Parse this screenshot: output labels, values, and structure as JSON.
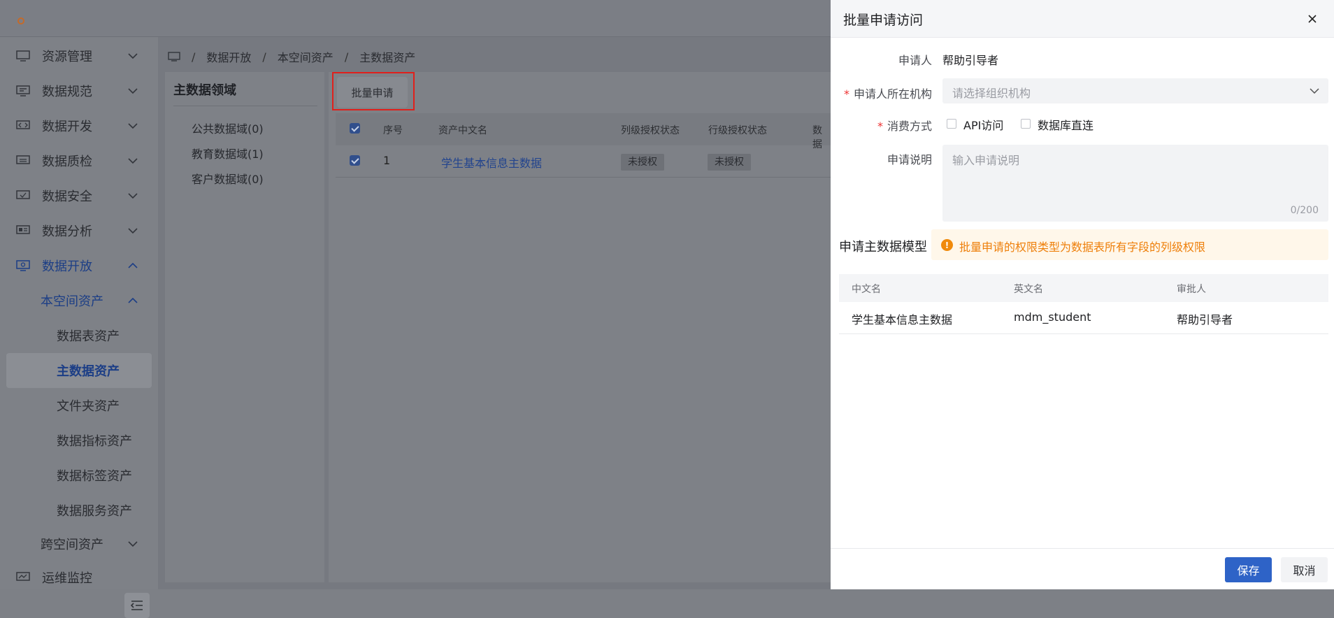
{
  "sidebar": {
    "items": [
      {
        "label": "资源管理"
      },
      {
        "label": "数据规范"
      },
      {
        "label": "数据开发"
      },
      {
        "label": "数据质检"
      },
      {
        "label": "数据安全"
      },
      {
        "label": "数据分析"
      },
      {
        "label": "数据开放"
      }
    ],
    "sub": {
      "label": "本空间资产"
    },
    "leaves": [
      {
        "label": "数据表资产"
      },
      {
        "label": "主数据资产"
      },
      {
        "label": "文件夹资产"
      },
      {
        "label": "数据指标资产"
      },
      {
        "label": "数据标签资产"
      },
      {
        "label": "数据服务资产"
      }
    ],
    "sub2": {
      "label": "跨空间资产"
    },
    "ops": {
      "label": "运维监控"
    }
  },
  "breadcrumb": [
    "数据开放",
    "本空间资产",
    "主数据资产"
  ],
  "left_panel": {
    "title": "主数据领域",
    "domains": [
      "公共数据域(0)",
      "教育数据域(1)",
      "客户数据域(0)"
    ]
  },
  "toolbar": {
    "batch_label": "批量申请"
  },
  "table": {
    "headers": [
      "序号",
      "资产中文名",
      "列级授权状态",
      "行级授权状态",
      "数据"
    ],
    "rows": [
      {
        "index": "1",
        "name": "学生基本信息主数据",
        "col_status": "未授权",
        "row_status": "未授权"
      }
    ]
  },
  "drawer": {
    "title": "批量申请访问",
    "applicant_label": "申请人",
    "applicant_value": "帮助引导者",
    "org_label": "申请人所在机构",
    "org_placeholder": "请选择组织机构",
    "consume_label": "消费方式",
    "consume_options": [
      "API访问",
      "数据库直连"
    ],
    "desc_label": "申请说明",
    "desc_placeholder": "输入申请说明",
    "desc_count": "0/200",
    "section_title": "申请主数据模型",
    "alert": "批量申请的权限类型为数据表所有字段的列级权限",
    "model_headers": [
      "中文名",
      "英文名",
      "审批人"
    ],
    "model_rows": [
      {
        "cn": "学生基本信息主数据",
        "en": "mdm_student",
        "approver": "帮助引导者"
      }
    ],
    "save_label": "保存",
    "cancel_label": "取消"
  }
}
